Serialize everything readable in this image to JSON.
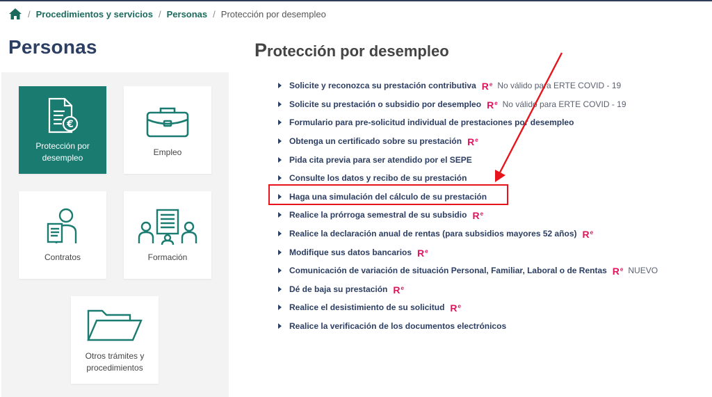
{
  "breadcrumb": {
    "home_icon": "home-icon",
    "items": [
      {
        "label": "Procedimientos y servicios"
      },
      {
        "label": "Personas"
      }
    ],
    "current": "Protección por desempleo"
  },
  "sidebar": {
    "title": "Personas",
    "tiles": [
      {
        "label": "Protección por desempleo",
        "icon": "document-euro-icon",
        "active": true
      },
      {
        "label": "Empleo",
        "icon": "briefcase-icon",
        "active": false
      },
      {
        "label": "Contratos",
        "icon": "person-document-icon",
        "active": false
      },
      {
        "label": "Formación",
        "icon": "training-icon",
        "active": false
      },
      {
        "label": "Otros trámites y procedimientos",
        "icon": "folder-icon",
        "active": false
      }
    ]
  },
  "main": {
    "title_first": "P",
    "title_rest": "rotección por desempleo",
    "links": [
      {
        "label": "Solicite y reconozca su prestación contributiva",
        "re": true,
        "note": "No válido para ERTE COVID - 19"
      },
      {
        "label": "Solicite su prestación o subsidio por desempleo",
        "re": true,
        "note": "No válido para ERTE COVID - 19"
      },
      {
        "label": "Formulario para pre-solicitud individual de prestaciones por desempleo",
        "re": false,
        "note": ""
      },
      {
        "label": "Obtenga un certificado sobre su prestación",
        "re": true,
        "note": ""
      },
      {
        "label": "Pida cita previa para ser atendido por el SEPE",
        "re": false,
        "note": ""
      },
      {
        "label": "Consulte los datos y recibo de su prestación",
        "re": false,
        "note": ""
      },
      {
        "label": "Haga una simulación del cálculo de su prestación",
        "re": false,
        "note": ""
      },
      {
        "label": "Realice la prórroga semestral de su subsidio",
        "re": true,
        "note": ""
      },
      {
        "label": "Realice la declaración anual de rentas (para subsidios mayores 52 años)",
        "re": true,
        "note": ""
      },
      {
        "label": "Modifique sus datos bancarios",
        "re": true,
        "note": ""
      },
      {
        "label": "Comunicación de variación de situación Personal, Familiar, Laboral o de Rentas",
        "re": true,
        "note": "NUEVO"
      },
      {
        "label": "Dé de baja su prestación",
        "re": true,
        "note": ""
      },
      {
        "label": "Realice el desistimiento de su solicitud",
        "re": true,
        "note": ""
      },
      {
        "label": "Realice la verificación de los documentos electrónicos",
        "re": false,
        "note": ""
      }
    ],
    "re_badge": "R",
    "re_badge_sup": "e"
  },
  "colors": {
    "accent_teal": "#1a7b71",
    "title_navy": "#2c3e62",
    "badge_pink": "#e0145c",
    "annotation_red": "#e8141b"
  }
}
